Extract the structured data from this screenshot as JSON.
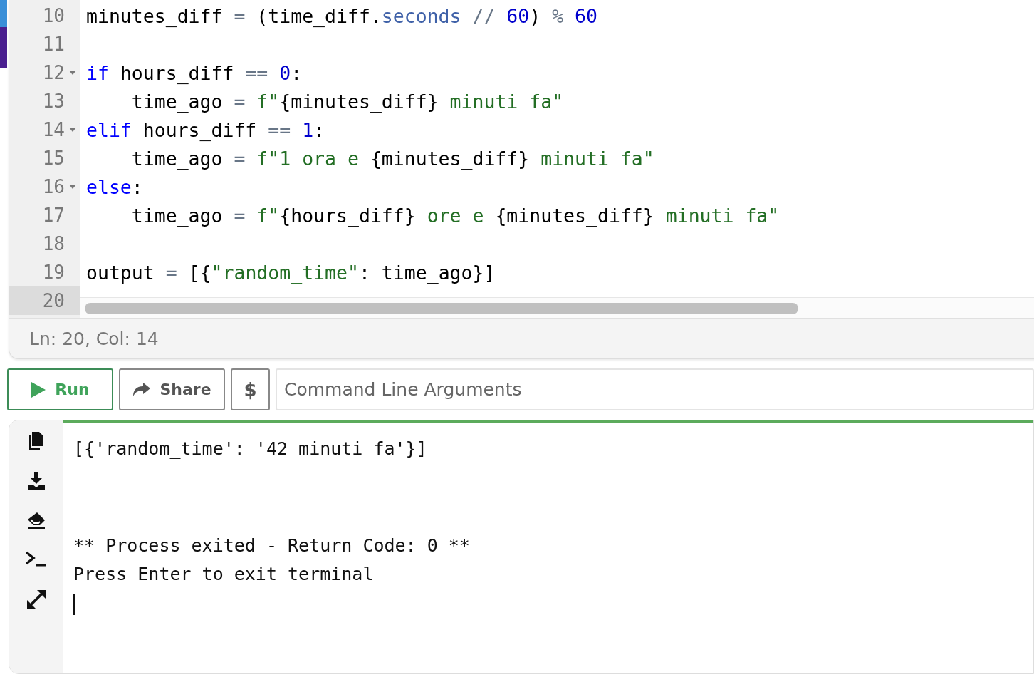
{
  "editor": {
    "lines": [
      {
        "number": "10",
        "foldable": false,
        "active": false,
        "tokens": [
          {
            "kind": "plain",
            "text": "minutes_diff"
          },
          {
            "kind": "op",
            "text": " = "
          },
          {
            "kind": "plain",
            "text": "(time_diff."
          },
          {
            "kind": "attr",
            "text": "seconds"
          },
          {
            "kind": "op",
            "text": " // "
          },
          {
            "kind": "num",
            "text": "60"
          },
          {
            "kind": "plain",
            "text": ")"
          },
          {
            "kind": "op",
            "text": " % "
          },
          {
            "kind": "num",
            "text": "60"
          }
        ]
      },
      {
        "number": "11",
        "foldable": false,
        "active": false
      },
      {
        "number": "12",
        "foldable": true,
        "active": false,
        "tokens": [
          {
            "kind": "kw",
            "text": "if"
          },
          {
            "kind": "plain",
            "text": " hours_diff"
          },
          {
            "kind": "op",
            "text": " == "
          },
          {
            "kind": "num",
            "text": "0"
          },
          {
            "kind": "plain",
            "text": ":"
          }
        ]
      },
      {
        "number": "13",
        "foldable": false,
        "active": false,
        "tokens": [
          {
            "kind": "plain",
            "text": "    time_ago"
          },
          {
            "kind": "op",
            "text": " = "
          },
          {
            "kind": "str",
            "text": "f\""
          },
          {
            "kind": "plain",
            "text": "{minutes_diff}"
          },
          {
            "kind": "str",
            "text": " minuti fa\""
          }
        ]
      },
      {
        "number": "14",
        "foldable": true,
        "active": false,
        "tokens": [
          {
            "kind": "kw",
            "text": "elif"
          },
          {
            "kind": "plain",
            "text": " hours_diff"
          },
          {
            "kind": "op",
            "text": " == "
          },
          {
            "kind": "num",
            "text": "1"
          },
          {
            "kind": "plain",
            "text": ":"
          }
        ]
      },
      {
        "number": "15",
        "foldable": false,
        "active": false,
        "tokens": [
          {
            "kind": "plain",
            "text": "    time_ago"
          },
          {
            "kind": "op",
            "text": " = "
          },
          {
            "kind": "str",
            "text": "f\"1 ora e "
          },
          {
            "kind": "plain",
            "text": "{minutes_diff}"
          },
          {
            "kind": "str",
            "text": " minuti fa\""
          }
        ]
      },
      {
        "number": "16",
        "foldable": true,
        "active": false,
        "tokens": [
          {
            "kind": "kw",
            "text": "else"
          },
          {
            "kind": "plain",
            "text": ":"
          }
        ]
      },
      {
        "number": "17",
        "foldable": false,
        "active": false,
        "tokens": [
          {
            "kind": "plain",
            "text": "    time_ago"
          },
          {
            "kind": "op",
            "text": " = "
          },
          {
            "kind": "str",
            "text": "f\""
          },
          {
            "kind": "plain",
            "text": "{hours_diff}"
          },
          {
            "kind": "str",
            "text": " ore e "
          },
          {
            "kind": "plain",
            "text": "{minutes_diff}"
          },
          {
            "kind": "str",
            "text": " minuti fa\""
          }
        ]
      },
      {
        "number": "18",
        "foldable": false,
        "active": false
      },
      {
        "number": "19",
        "foldable": false,
        "active": false,
        "tokens": [
          {
            "kind": "plain",
            "text": "output"
          },
          {
            "kind": "op",
            "text": " = "
          },
          {
            "kind": "plain",
            "text": "[{"
          },
          {
            "kind": "str",
            "text": "\"random_time\""
          },
          {
            "kind": "plain",
            "text": ": time_ago}]"
          }
        ]
      },
      {
        "number": "20",
        "foldable": false,
        "active": true
      }
    ],
    "status": "Ln: 20,  Col: 14"
  },
  "toolbar": {
    "run": "Run",
    "share": "Share",
    "dollar": "$",
    "args_placeholder": "Command Line Arguments"
  },
  "terminal": {
    "lines": [
      {
        "kind": "result",
        "text": "[{'random_time': '42 minuti fa'}]"
      },
      {
        "kind": "exit",
        "text": "** Process exited - Return Code: 0 **"
      },
      {
        "kind": "prompt",
        "text": "Press Enter to exit terminal"
      }
    ],
    "cursor": true
  }
}
